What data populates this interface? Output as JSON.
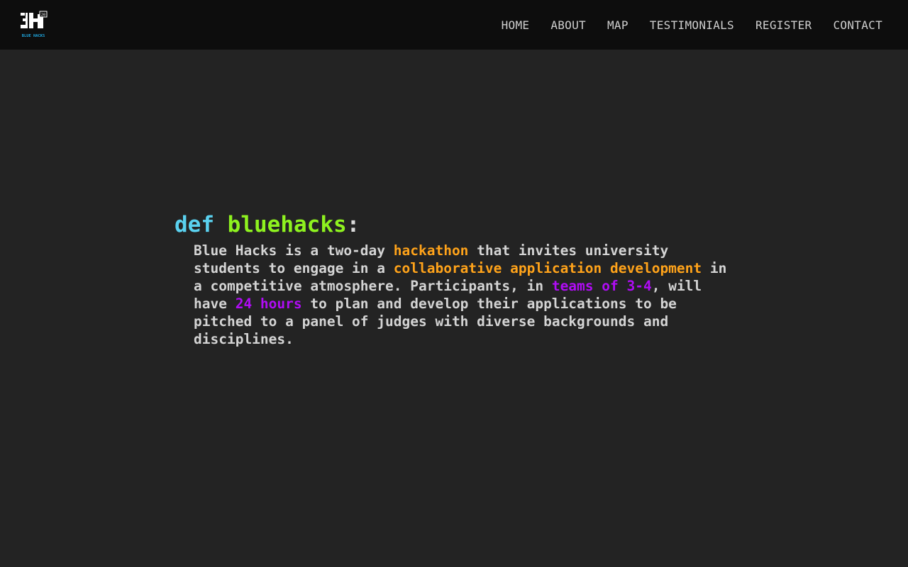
{
  "brand": {
    "logo_text": "BH",
    "logo_subtext": "BLUE HACKS",
    "logo_badge": "20"
  },
  "nav": {
    "items": [
      {
        "label": "HOME"
      },
      {
        "label": "ABOUT"
      },
      {
        "label": "MAP"
      },
      {
        "label": "TESTIMONIALS"
      },
      {
        "label": "REGISTER"
      },
      {
        "label": "CONTACT"
      }
    ]
  },
  "hero": {
    "keyword": "def",
    "function_name": "bluehacks",
    "colon": ":",
    "description": {
      "part1": "Blue Hacks is a two-day ",
      "hl1": "hackathon",
      "part2": " that invites university students to engage in a ",
      "hl2": "collaborative application development",
      "part3": " in a competitive atmosphere. Participants, in ",
      "hl3": "teams of 3-4",
      "part4": ", will have ",
      "hl4": "24 hours",
      "part5": " to plan and develop their applications to be pitched to a panel of judges with diverse backgrounds and disciplines."
    }
  },
  "colors": {
    "background": "#232323",
    "navbar": "#0d0d0d",
    "keyword": "#5ad1ef",
    "function": "#8ef21f",
    "highlight_orange": "#ffa31a",
    "highlight_purple": "#b00cf5",
    "logo_accent": "#1fa8e0"
  }
}
